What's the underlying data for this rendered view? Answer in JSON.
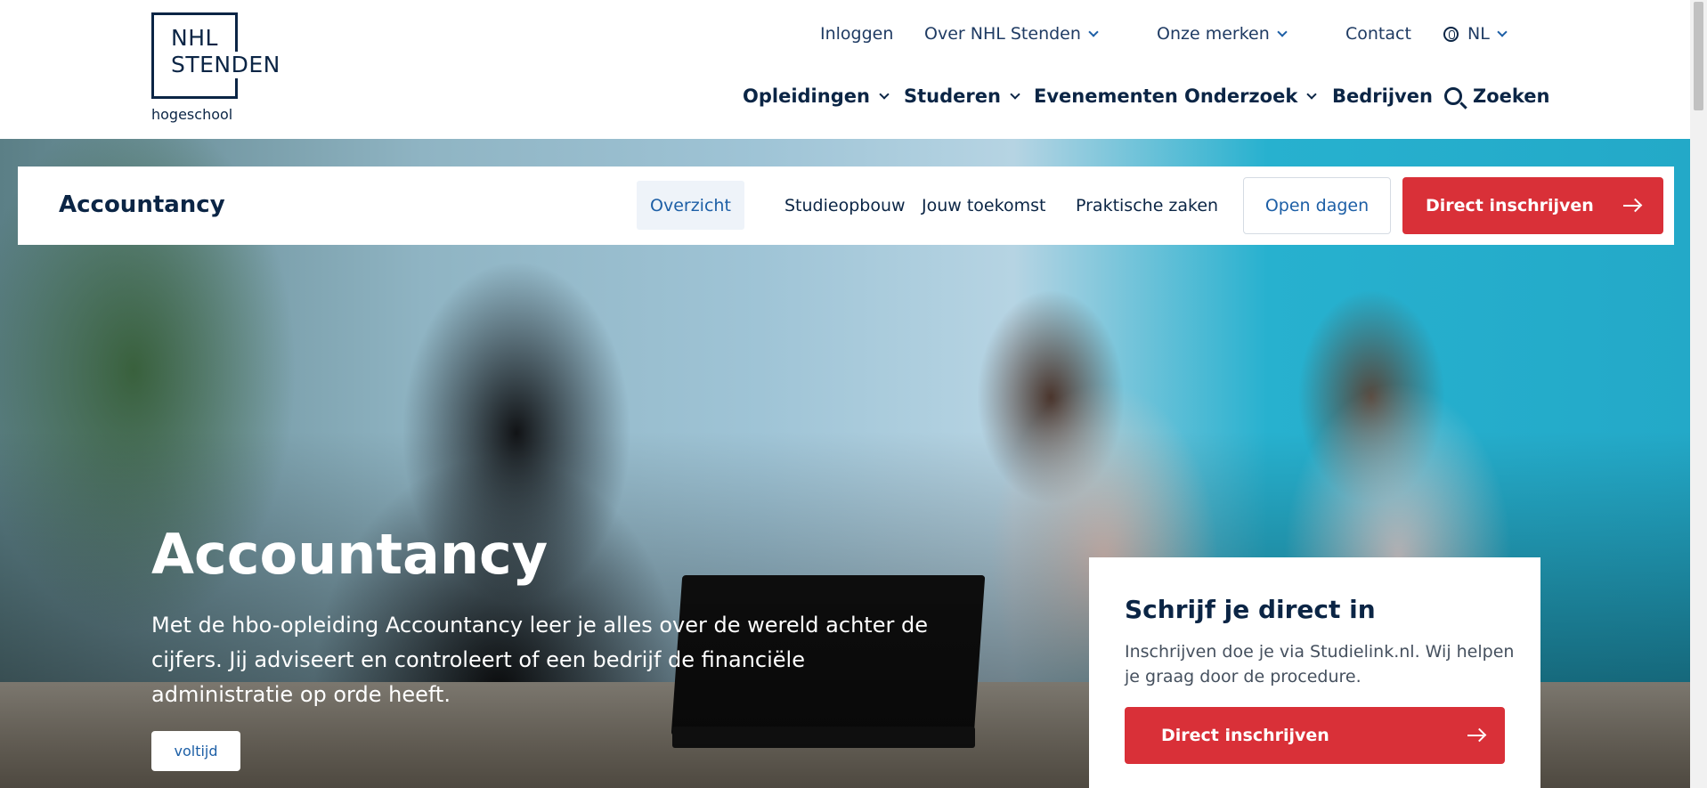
{
  "logo": {
    "line1": "NHL",
    "line2": "STENDEN",
    "sub": "hogeschool"
  },
  "topnav": {
    "login": "Inloggen",
    "about": "Over NHL Stenden",
    "brands": "Onze merken",
    "contact": "Contact",
    "language": "NL"
  },
  "mainnav": {
    "programs": "Opleidingen",
    "studying": "Studeren",
    "events": "Evenementen",
    "research": "Onderzoek",
    "companies": "Bedrijven",
    "search": "Zoeken"
  },
  "subnav": {
    "title": "Accountancy",
    "tabs": [
      "Overzicht",
      "Studieopbouw",
      "Jouw toekomst",
      "Praktische zaken"
    ],
    "open_days": "Open dagen",
    "enroll": "Direct inschrijven"
  },
  "hero": {
    "title": "Accountancy",
    "text": "Met de hbo-opleiding Accountancy leer je alles over de wereld achter de cijfers. Jij adviseert en controleert of een bedrijf de financiële administratie op orde heeft.",
    "more": "voltijd"
  },
  "card": {
    "title": "Schrijf je direct in",
    "text": "Inschrijven doe je via Studielink.nl. Wij helpen je graag door de procedure.",
    "button": "Direct inschrijven"
  },
  "colors": {
    "navy": "#0b2545",
    "accent_blue": "#1d5fa6",
    "red": "#d93038"
  }
}
